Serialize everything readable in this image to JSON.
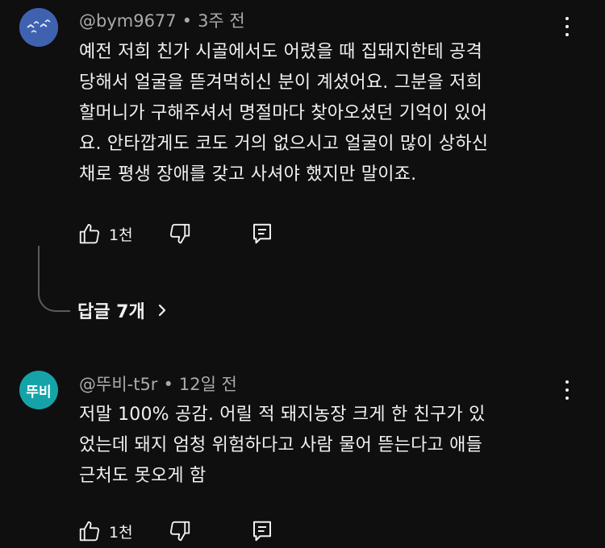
{
  "comments": [
    {
      "handle": "@bym9677",
      "time": "3주 전",
      "body": "예전 저희 친가 시골에서도 어렸을 때 집돼지한테 공격\n당해서 얼굴을 뜯겨먹히신 분이 계셨어요. 그분을 저희\n할머니가 구해주셔서 명절마다 찾아오셨던 기억이 있어\n요. 안타깝게도 코도 거의 없으시고 얼굴이 많이 상하신\n채로 평생 장애를 갖고 사셔야 했지만 말이죠.",
      "likes": "1천",
      "avatar_icon": "birds-icon",
      "replies_label": "답글 7개"
    },
    {
      "handle": "@뚜비-t5r",
      "time": "12일 전",
      "body": "저말 100% 공감. 어릴 적 돼지농장 크게 한 친구가 있\n었는데 돼지 엄청 위험하다고 사람 물어 뜯는다고 애들\n근처도 못오게 함",
      "likes": "1천",
      "avatar_text": "뚜비"
    }
  ],
  "colors": {
    "background": "#0f0f0f",
    "text": "#f1f1f1",
    "meta": "#aaaaaa",
    "avatar1": "#3f62b0",
    "avatar2": "#15a3a8"
  }
}
